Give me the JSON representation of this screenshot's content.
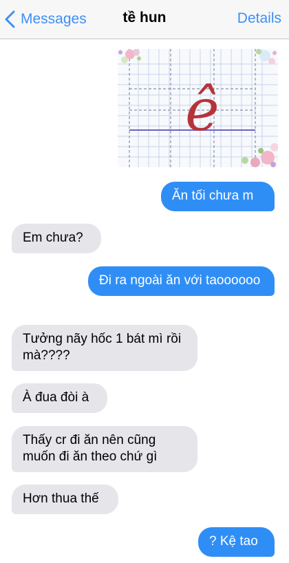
{
  "nav": {
    "back_label": "Messages",
    "title": "tề hun",
    "details_label": "Details"
  },
  "attachment": {
    "letter": "ê"
  },
  "messages": [
    {
      "direction": "out",
      "text": "Ăn tối chưa m"
    },
    {
      "direction": "in",
      "text": "Em chưa?"
    },
    {
      "direction": "out",
      "text": "Đi ra ngoài ăn với taoooooo"
    },
    {
      "direction": "in",
      "text": "Tưởng nãy hốc 1 bát mì rồi mà????"
    },
    {
      "direction": "in",
      "text": "À đua đòi à"
    },
    {
      "direction": "in",
      "text": "Thấy cr đi ăn nên cũng muốn đi ăn theo chứ gì"
    },
    {
      "direction": "in",
      "text": "Hơn thua thế"
    },
    {
      "direction": "out",
      "text": "? Kệ tao"
    }
  ],
  "colors": {
    "accent": "#3d8ff5",
    "outgoing_bubble": "#2f8ef6",
    "incoming_bubble": "#e5e5ea",
    "navbar_bg": "#f7f7f8"
  }
}
